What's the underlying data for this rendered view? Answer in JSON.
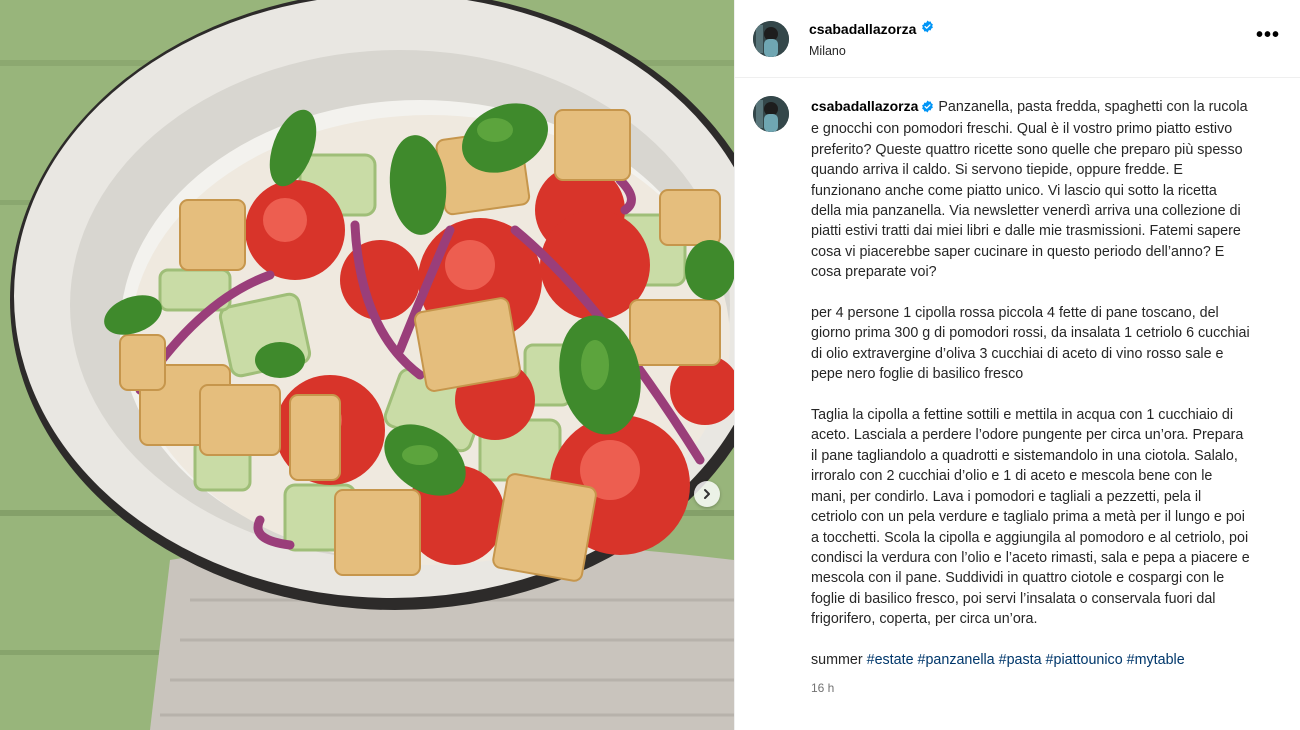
{
  "post": {
    "username": "csabadallazorza",
    "location": "Milano",
    "more_icon": "more-horizontal-icon",
    "verified_color": "#0095f6",
    "caption_paragraphs": [
      "Panzanella, pasta fredda, spaghetti con la rucola e gnocchi con pomodori freschi. Qual è il vostro primo piatto estivo preferito? Queste quattro ricette sono quelle che preparo più spesso quando arriva il caldo. Si servono tiepide, oppure fredde. E funzionano anche come piatto unico. Vi lascio qui sotto la ricetta della mia panzanella. Via newsletter venerdì arriva una collezione di piatti estivi tratti dai miei libri e dalle mie trasmissioni. Fatemi sapere cosa vi piacerebbe saper cucinare in questo periodo dell’anno? E cosa preparate voi?",
      "per 4 persone 1 cipolla rossa piccola 4 fette di pane toscano, del giorno prima 300 g di pomodori rossi, da insalata 1 cetriolo 6 cucchiai di olio extravergine d’oliva 3 cucchiai di aceto di vino rosso sale e pepe nero foglie di basilico fresco",
      "Taglia la cipolla a fettine sottili e mettila in acqua con 1 cucchiaio di aceto. Lasciala a perdere l’odore pungente per circa un’ora. Prepara il pane tagliandolo a quadrotti e sistemandolo in una ciotola. Salalo, irroralo con 2 cucchiai d’olio e 1 di aceto e mescola bene con le mani, per condirlo. Lava i pomodori e tagliali a pezzetti, pela il cetriolo con un pela verdure e taglialo prima a metà per il lungo e poi a tocchetti. Scola la cipolla e aggiungila al pomodoro e al cetriolo, poi condisci la verdura con l’olio e l’aceto rimasti, sala e pepa a piacere e mescola con il pane. Suddividi in quattro ciotole e cospargi con le foglie di basilico fresco, poi servi l’insalata o conservala fuori dal frigorifero, coperta, per circa un’ora."
    ],
    "caption_tail_word": "summer",
    "hashtags": [
      "#estate",
      "#panzanella",
      "#pasta",
      "#piattounico",
      "#mytable"
    ],
    "timestamp": "16 h",
    "hashtag_color": "#00376b"
  },
  "media": {
    "next_icon": "chevron-right-icon"
  }
}
